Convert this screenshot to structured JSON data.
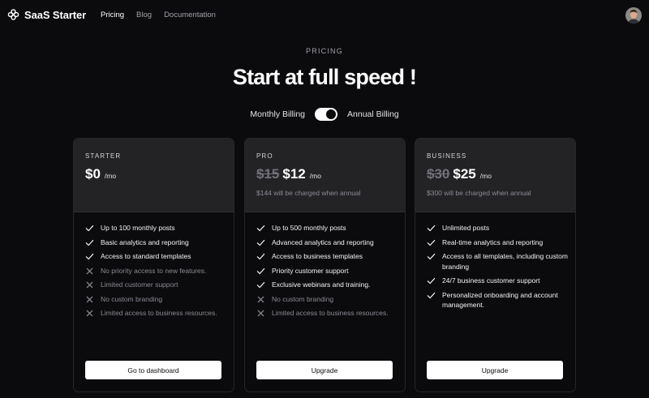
{
  "header": {
    "brand": "SaaS Starter",
    "logo_icon": "asterisk-flower-icon",
    "nav": [
      {
        "label": "Pricing",
        "active": true
      },
      {
        "label": "Blog",
        "active": false
      },
      {
        "label": "Documentation",
        "active": false
      }
    ],
    "avatar_icon": "user-avatar"
  },
  "hero": {
    "eyebrow": "PRICING",
    "title": "Start at full speed !",
    "billing_monthly": "Monthly Billing",
    "billing_annual": "Annual Billing",
    "annual_selected": true
  },
  "plans": [
    {
      "name": "STARTER",
      "old_price": "",
      "price": "$0",
      "per": "/mo",
      "annual_note": "",
      "features": [
        {
          "text": "Up to 100 monthly posts",
          "included": true
        },
        {
          "text": "Basic analytics and reporting",
          "included": true
        },
        {
          "text": "Access to standard templates",
          "included": true
        },
        {
          "text": "No priority access to new features.",
          "included": false
        },
        {
          "text": "Limited customer support",
          "included": false
        },
        {
          "text": "No custom branding",
          "included": false
        },
        {
          "text": "Limited access to business resources.",
          "included": false
        }
      ],
      "cta": "Go to dashboard"
    },
    {
      "name": "PRO",
      "old_price": "$15",
      "price": "$12",
      "per": "/mo",
      "annual_note": "$144 will be charged when annual",
      "features": [
        {
          "text": "Up to 500 monthly posts",
          "included": true
        },
        {
          "text": "Advanced analytics and reporting",
          "included": true
        },
        {
          "text": "Access to business templates",
          "included": true
        },
        {
          "text": "Priority customer support",
          "included": true
        },
        {
          "text": "Exclusive webinars and training.",
          "included": true
        },
        {
          "text": "No custom branding",
          "included": false
        },
        {
          "text": "Limited access to business resources.",
          "included": false
        }
      ],
      "cta": "Upgrade"
    },
    {
      "name": "BUSINESS",
      "old_price": "$30",
      "price": "$25",
      "per": "/mo",
      "annual_note": "$300 will be charged when annual",
      "features": [
        {
          "text": "Unlimited posts",
          "included": true
        },
        {
          "text": "Real-time analytics and reporting",
          "included": true
        },
        {
          "text": "Access to all templates, including custom branding",
          "included": true
        },
        {
          "text": "24/7 business customer support",
          "included": true
        },
        {
          "text": "Personalized onboarding and account management.",
          "included": true
        }
      ],
      "cta": "Upgrade"
    }
  ],
  "icons": {
    "included": "check-icon",
    "excluded": "x-icon"
  },
  "colors": {
    "background": "#0b0b0d",
    "card_header": "#232326",
    "button": "#ffffff",
    "muted": "#8b8b94"
  }
}
